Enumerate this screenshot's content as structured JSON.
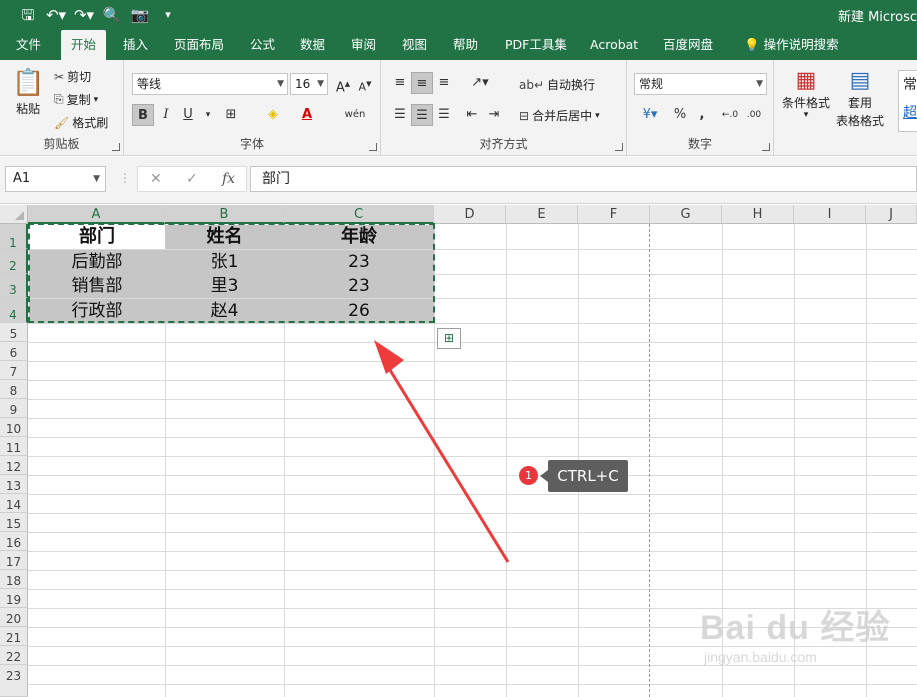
{
  "app": {
    "title": "新建 Microsc",
    "accent": "#217346",
    "qat": [
      "save-icon",
      "undo-icon",
      "redo-icon",
      "print-preview-icon",
      "camera-icon",
      "customize-icon"
    ]
  },
  "tabs": [
    "文件",
    "开始",
    "插入",
    "页面布局",
    "公式",
    "数据",
    "审阅",
    "视图",
    "帮助",
    "PDF工具集",
    "Acrobat",
    "百度网盘",
    "操作说明搜索"
  ],
  "active_tab": "开始",
  "ribbon": {
    "clipboard": {
      "label": "剪贴板",
      "paste": "粘贴",
      "cut": "剪切",
      "copy": "复制",
      "format_painter": "格式刷"
    },
    "font": {
      "label": "字体",
      "name": "等线",
      "size": "16",
      "bold": "B",
      "italic": "I",
      "underline": "U",
      "grow": "A",
      "shrink": "A",
      "phonetic": "wén"
    },
    "alignment": {
      "label": "对齐方式",
      "wrap": "自动换行",
      "merge": "合并后居中"
    },
    "number": {
      "label": "数字",
      "format": "常规",
      "percent": "%",
      "comma": ","
    },
    "styles": {
      "conditional": "条件格式",
      "table": "套用",
      "table2": "表格格式",
      "cell_style_1": "常",
      "cell_style_2": "超"
    }
  },
  "formula_bar": {
    "name_box": "A1",
    "cancel": "✕",
    "enter": "✓",
    "fx": "fx",
    "content": "部门"
  },
  "columns": [
    "A",
    "B",
    "C",
    "D",
    "E",
    "F",
    "G",
    "H",
    "I",
    "J"
  ],
  "rows": [
    "1",
    "2",
    "3",
    "4",
    "5",
    "6",
    "7",
    "8",
    "9",
    "10",
    "11",
    "12",
    "13",
    "14",
    "15",
    "16",
    "17",
    "18",
    "19",
    "20",
    "21",
    "22",
    "23"
  ],
  "cells": [
    [
      "部门",
      "姓名",
      "年龄"
    ],
    [
      "后勤部",
      "张1",
      "23"
    ],
    [
      "销售部",
      "里3",
      "23"
    ],
    [
      "行政部",
      "赵4",
      "26"
    ]
  ],
  "annotation": {
    "step": "1",
    "text": "CTRL+C",
    "arrow_color": "#ee3b3b"
  },
  "watermark": {
    "line1": "Bai du 经验",
    "line2": "jingyan.baidu.com"
  }
}
